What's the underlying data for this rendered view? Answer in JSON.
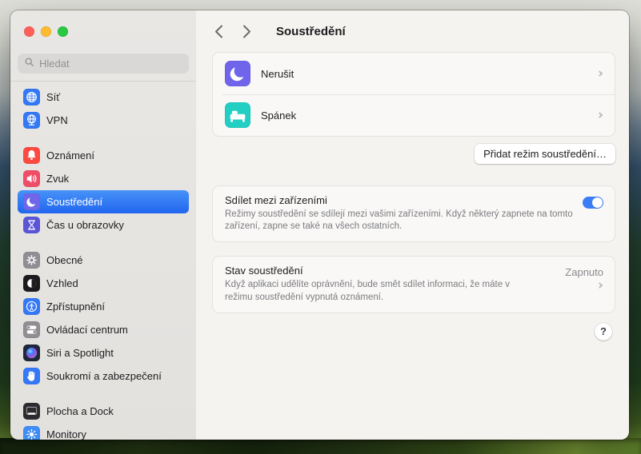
{
  "colors": {
    "accent": "#3478f6",
    "sidebar_selected_top": "#4792f8",
    "sidebar_selected_bottom": "#2166ee",
    "toggle_on": "#3a7df7"
  },
  "sidebar": {
    "search_placeholder": "Hledat",
    "groups": [
      {
        "items": [
          {
            "key": "sit",
            "label": "Síť",
            "icon": "globe-icon",
            "color": "#3478f6"
          },
          {
            "key": "vpn",
            "label": "VPN",
            "icon": "vpn-globe-icon",
            "color": "#3478f6"
          }
        ]
      },
      {
        "items": [
          {
            "key": "oznameni",
            "label": "Oznámení",
            "icon": "bell-icon",
            "color": "#fc4a42"
          },
          {
            "key": "zvuk",
            "label": "Zvuk",
            "icon": "speaker-icon",
            "color": "#ef4e68"
          },
          {
            "key": "soustredeni",
            "label": "Soustředění",
            "icon": "moon-icon",
            "color": "#7066e9",
            "selected": true
          },
          {
            "key": "cas-u-obrazovky",
            "label": "Čas u obrazovky",
            "icon": "hourglass-icon",
            "color": "#5a55d6"
          }
        ]
      },
      {
        "items": [
          {
            "key": "obecne",
            "label": "Obecné",
            "icon": "gear-icon",
            "color": "#8e8e93"
          },
          {
            "key": "vzhled",
            "label": "Vzhled",
            "icon": "appearance-icon",
            "color": "#1b1b1d"
          },
          {
            "key": "zpristupneni",
            "label": "Zpřístupnění",
            "icon": "accessibility-icon",
            "color": "#3478f6"
          },
          {
            "key": "ovladaci-centrum",
            "label": "Ovládací centrum",
            "icon": "control-center-icon",
            "color": "#8e8e93"
          },
          {
            "key": "siri-a-spotlight",
            "label": "Siri a Spotlight",
            "icon": "siri-icon",
            "color": "#20263a"
          },
          {
            "key": "soukromi-a-zabezpeceni",
            "label": "Soukromí a zabezpečení",
            "icon": "hand-icon",
            "color": "#3478f6"
          }
        ]
      },
      {
        "items": [
          {
            "key": "plocha-a-dock",
            "label": "Plocha a Dock",
            "icon": "dock-icon",
            "color": "#2c2c2e"
          },
          {
            "key": "monitory",
            "label": "Monitory",
            "icon": "display-icon",
            "color": "#3e8df6"
          }
        ]
      }
    ]
  },
  "header": {
    "title": "Soustředění"
  },
  "main": {
    "focus_modes": [
      {
        "key": "nerusit",
        "label": "Nerušit",
        "icon": "moon-icon",
        "color": "#6f64ea"
      },
      {
        "key": "spanek",
        "label": "Spánek",
        "icon": "bed-icon",
        "color": "#22cfc2"
      }
    ],
    "add_button_label": "Přidat režim soustředění…",
    "share": {
      "title": "Sdílet mezi zařízeními",
      "description": "Režimy soustředění se sdílejí mezi vašimi zařízeními. Když některý zapnete na tomto zařízení, zapne se také na všech ostatních.",
      "enabled": true
    },
    "status": {
      "title": "Stav soustředění",
      "description": "Když aplikaci udělíte oprávnění, bude smět sdílet informaci, že máte v režimu soustředění vypnutá oznámení.",
      "value": "Zapnuto"
    },
    "help_label": "?"
  }
}
